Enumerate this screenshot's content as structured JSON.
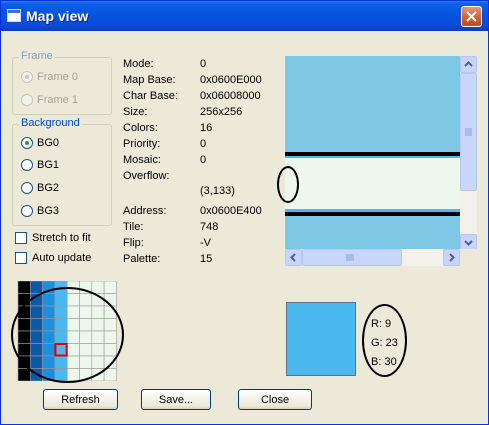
{
  "window": {
    "title": "Map view"
  },
  "frame_group": {
    "legend": "Frame",
    "options": [
      {
        "label": "Frame 0",
        "selected": true
      },
      {
        "label": "Frame 1",
        "selected": false
      }
    ]
  },
  "background_group": {
    "legend": "Background",
    "options": [
      {
        "label": "BG0",
        "selected": true
      },
      {
        "label": "BG1",
        "selected": false
      },
      {
        "label": "BG2",
        "selected": false
      },
      {
        "label": "BG3",
        "selected": false
      }
    ]
  },
  "checkboxes": {
    "stretch": {
      "label": "Stretch to fit",
      "checked": false
    },
    "auto_update": {
      "label": "Auto update",
      "checked": false
    }
  },
  "info": {
    "mode": {
      "label": "Mode:",
      "value": "0"
    },
    "map_base": {
      "label": "Map Base:",
      "value": "0x0600E000"
    },
    "char_base": {
      "label": "Char Base:",
      "value": "0x06008000"
    },
    "size": {
      "label": "Size:",
      "value": "256x256"
    },
    "colors": {
      "label": "Colors:",
      "value": "16"
    },
    "priority": {
      "label": "Priority:",
      "value": "0"
    },
    "mosaic": {
      "label": "Mosaic:",
      "value": "0"
    },
    "overflow": {
      "label": "Overflow:",
      "value": ""
    },
    "coords": "(3,133)",
    "address": {
      "label": "Address:",
      "value": "0x0600E400"
    },
    "tile": {
      "label": "Tile:",
      "value": "748"
    },
    "flip": {
      "label": "Flip:",
      "value": "-V"
    },
    "palette": {
      "label": "Palette:",
      "value": "15"
    }
  },
  "color_info": {
    "swatch_color": "#4ab9ef",
    "r": "R: 9",
    "g": "G: 23",
    "b": "B: 30"
  },
  "buttons": {
    "refresh": "Refresh",
    "save": "Save...",
    "close": "Close"
  },
  "colors": {
    "sky": "#7ec7e5",
    "band_fill": "#eef7ee",
    "tile_white": "#eef7ec",
    "tile_blue": "#4ab9ef",
    "tile_mid": "#1d8fe0",
    "tile_dark": "#0a5aa8",
    "selection": "#e00000"
  }
}
